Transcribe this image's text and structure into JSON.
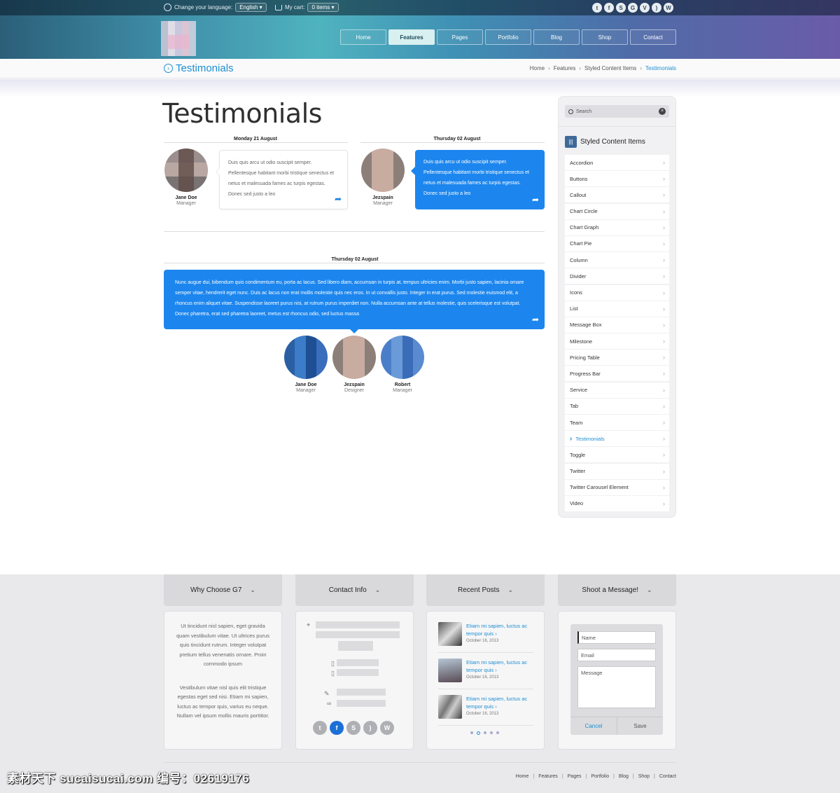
{
  "topbar": {
    "language_label": "Change your language:",
    "language_value": "English",
    "cart_label": "My cart:",
    "cart_value": "0 items",
    "social_icons": [
      "twitter-icon",
      "facebook-icon",
      "skype-icon",
      "google-plus-icon",
      "vimeo-icon",
      "rss-icon",
      "wordpress-icon"
    ]
  },
  "nav": {
    "items": [
      "Home",
      "Features",
      "Pages",
      "Portfolio",
      "Blog",
      "Shop",
      "Contact"
    ],
    "active": "Features"
  },
  "breadcrumb": {
    "title": "Testimonials",
    "items": [
      "Home",
      "Features",
      "Styled Content Items",
      "Testimonials"
    ]
  },
  "main": {
    "page_title": "Testimonials",
    "group1": {
      "date": "Monday 21 August",
      "person": {
        "name": "Jane Doe",
        "role": "Manager"
      },
      "text": "Duis quis arcu ut odio suscipit semper. Pellentesque habitant morbi tristique senectus et netus et malesuada fames ac turpis egestas. Donec sed justo a leo"
    },
    "group2": {
      "date": "Thursday 02 August",
      "person": {
        "name": "Jezspain",
        "role": "Manager"
      },
      "text": "Duis quis arcu ut odio suscipit semper. Pellentesque habitant morbi tristique senectus et netus et malesuada fames ac turpis egestas. Donec sed justo a leo"
    },
    "group3": {
      "date": "Thursday 02 August",
      "text": "Nunc augue dui, bibendum quis condimentum eu, porta ac lacus. Sed libero diam, accumsan in turpis at, tempus ultricies enim. Morbi justo sapien, lacinia ornare semper vitae, hendrerit eget nunc. Duis ac lacus non erat mollis molestie quis nec eros. In ut convallis justo. Integer in erat purus. Sed molestie euismod elit, a rhoncus enim aliquet vitae. Suspendisse laoreet purus nisi, at rutrum purus imperdiet non. Nulla accumsan ante at tellus molestie, quis scelerisque est volutpat. Donec pharetra, erat sed pharetra laoreet, metus est rhoncus odio, sed luctus massa",
      "people": [
        {
          "name": "Jane Doe",
          "role": "Manager"
        },
        {
          "name": "Jezspain",
          "role": "Designer"
        },
        {
          "name": "Robert",
          "role": "Manager"
        }
      ]
    }
  },
  "sidebar": {
    "search_placeholder": "Search",
    "heading": "Styled Content Items",
    "items": [
      "Accordion",
      "Buttons",
      "Callout",
      "Chart Circle",
      "Chart Graph",
      "Chart Pie",
      "Column",
      "Divider",
      "Icons",
      "List",
      "Message Box",
      "Milestone",
      "Pricing Table",
      "Progress Bar",
      "Service",
      "Tab",
      "Team",
      "Testimonials",
      "Toggle",
      "Twitter",
      "Twitter Carousel Element",
      "Video"
    ],
    "active": "Testimonials"
  },
  "footer": {
    "tabs": [
      "Why Choose G7",
      "Contact Info",
      "Recent Posts",
      "Shoot a Message!"
    ],
    "why_text_1": "Ut tincidunt nisl sapien, eget gravida quam vestibulum vitae. Ut ultrices purus quis tincidunt rutrum. Integer volutpat pretium tellus venenatis ornare. Proin commodo ipsum",
    "why_text_2": "Vestibulum vitae nisl quis elit tristique egestas eget sed nisi. Etiam mi sapien, luctus ac tempor quis, varius eu neque. Nullam vel ipsum mollis mauris porttitor.",
    "contact_socials": [
      "twitter-icon",
      "facebook-icon",
      "skype-icon",
      "rss-icon",
      "wordpress-icon"
    ],
    "posts": [
      {
        "title": "Etiam mi sapien, luctus ac tempor quis",
        "date": "October 16, 2013"
      },
      {
        "title": "Etiam mi sapien, luctus ac tempor quis",
        "date": "October 16, 2013"
      },
      {
        "title": "Etiam mi sapien, luctus ac tempor quis",
        "date": "October 16, 2013"
      }
    ],
    "form": {
      "name_placeholder": "Name",
      "email_placeholder": "Email",
      "message_placeholder": "Message",
      "cancel": "Cancel",
      "save": "Save"
    },
    "bottom_nav": [
      "Home",
      "Features",
      "Pages",
      "Portfolio",
      "Blog",
      "Shop",
      "Contact"
    ]
  },
  "watermark": "素材天下 sucaisucai.com  编号：02619176",
  "colors": {
    "accent": "#1e8fd0",
    "bubble_blue": "#1c86ee",
    "footer_bg": "#e9e9eb"
  }
}
